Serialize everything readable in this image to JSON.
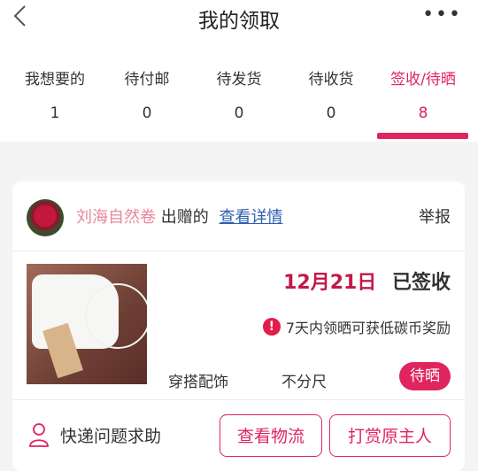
{
  "header": {
    "title": "我的领取",
    "more_label": "•••"
  },
  "tabs": [
    {
      "label": "我想要的",
      "count": "1"
    },
    {
      "label": "待付邮",
      "count": "0"
    },
    {
      "label": "待发货",
      "count": "0"
    },
    {
      "label": "待收货",
      "count": "0"
    },
    {
      "label": "签收/待晒",
      "count": "8"
    }
  ],
  "card": {
    "giver": "刘海自然卷",
    "gift_text": "出赠的",
    "detail_link": "查看详情",
    "report": "举报",
    "date": "12月21日",
    "status": "已签收",
    "reward_icon": "!",
    "reward_text": "7天内领晒可获低碳币奖励",
    "category": "穿搭配饰",
    "size": "不分尺",
    "badge": "待晒",
    "help_text": "快递问题求助",
    "btn_logistics": "查看物流",
    "btn_tip": "打赏原主人"
  },
  "colors": {
    "accent": "#e0245e",
    "link": "#2e5fb0",
    "giver": "#e8879e"
  }
}
